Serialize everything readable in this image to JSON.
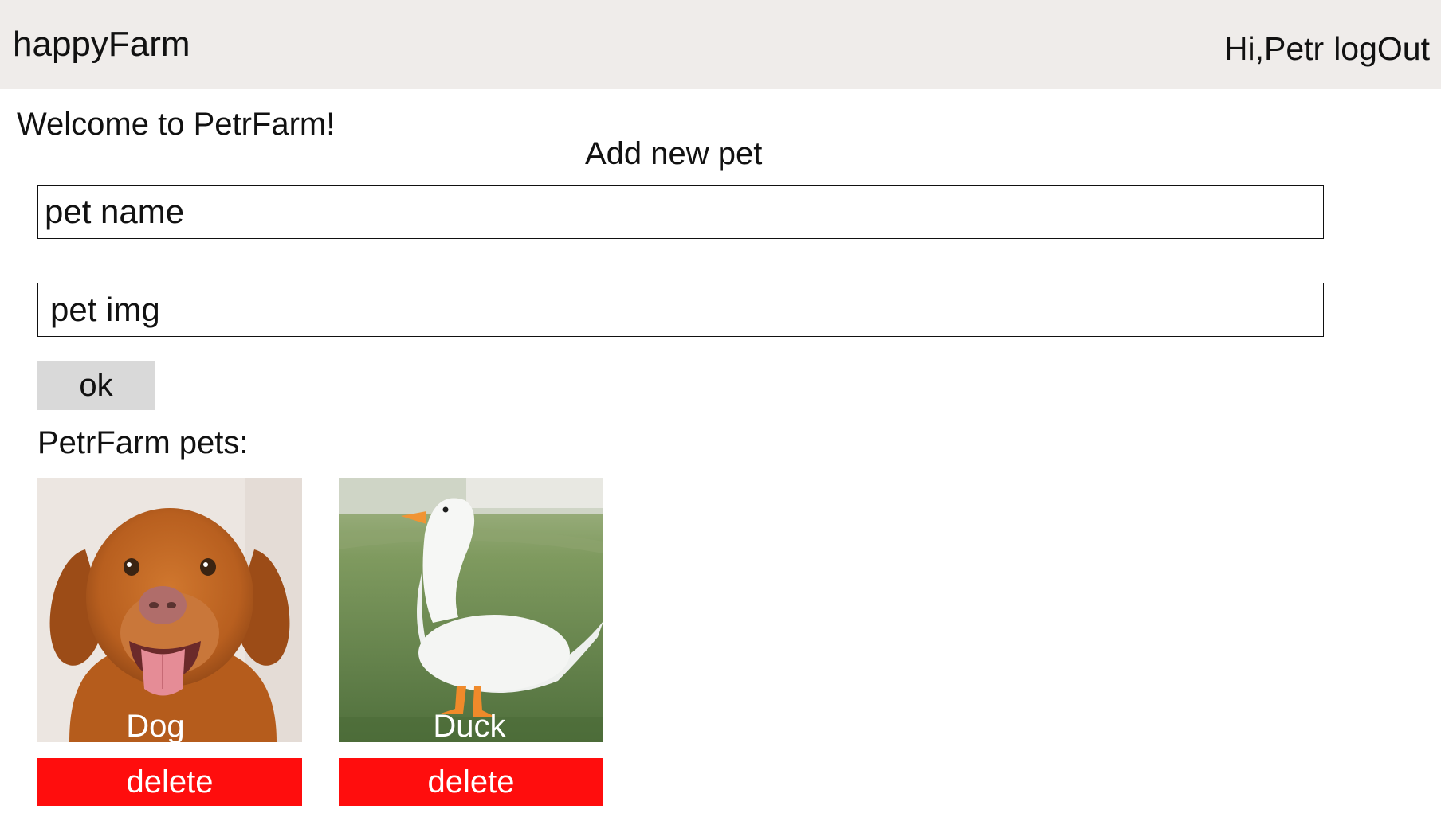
{
  "header": {
    "brand": "happyFarm",
    "greeting": "Hi,Petr",
    "logout_label": "logOut",
    "background": "#efecea"
  },
  "main": {
    "welcome": "Welcome to PetrFarm!",
    "form": {
      "title": "Add new pet",
      "name_placeholder": "pet name",
      "img_placeholder": "pet img",
      "submit_label": "ok"
    },
    "pets_heading": "PetrFarm pets:",
    "pets": [
      {
        "name": "Dog",
        "image_icon": "dog-photo",
        "delete_label": "delete"
      },
      {
        "name": "Duck",
        "image_icon": "duck-photo",
        "delete_label": "delete"
      }
    ]
  },
  "colors": {
    "delete": "#ff0d0d",
    "ok_button": "#d9d9d9"
  }
}
